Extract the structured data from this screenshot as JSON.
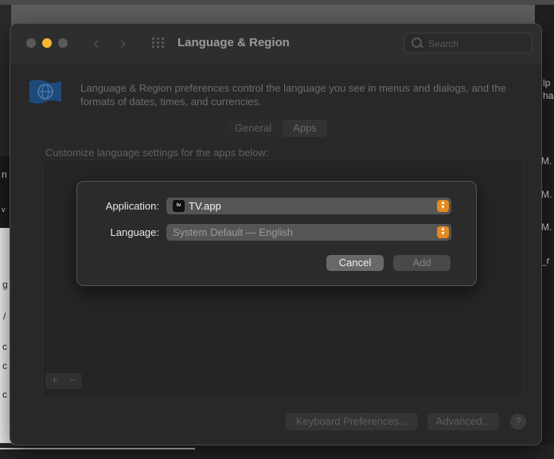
{
  "window": {
    "title": "Language & Region",
    "search_placeholder": "Search",
    "description": "Language & Region preferences control the language you see in menus and dialogs, and the formats of dates, times, and currencies.",
    "tabs": [
      {
        "label": "General",
        "selected": false
      },
      {
        "label": "Apps",
        "selected": true
      }
    ],
    "customize_text": "Customize language settings for the apps below:",
    "add_button": "+",
    "remove_button": "−",
    "keyboard_button": "Keyboard Preferences...",
    "advanced_button": "Advanced...",
    "help_button": "?"
  },
  "dialog": {
    "application_label": "Application:",
    "application_value": "TV.app",
    "application_icon_text": "tv",
    "language_label": "Language:",
    "language_value": "System Default — English",
    "cancel_button": "Cancel",
    "add_button": "Add"
  },
  "background_fragments": {
    "right": [
      "lp",
      "ha",
      "M.",
      "M.",
      "M.",
      "_r"
    ],
    "left": [
      "n",
      "v",
      "g",
      "/",
      "c",
      "c",
      "c"
    ]
  },
  "colors": {
    "accent_orange": "#e58a1f",
    "minimize_yellow": "#f5b82e",
    "window_bg": "#282828",
    "dialog_bg": "#2c2b2b"
  }
}
